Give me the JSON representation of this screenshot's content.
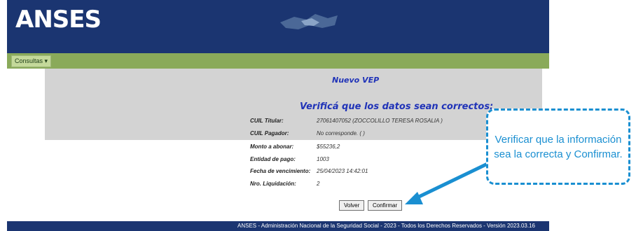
{
  "header": {
    "logo_text": "ANSES"
  },
  "menu": {
    "consultas_label": "Consultas"
  },
  "page": {
    "title": "Nuevo VEP",
    "verify_heading": "Verificá que los datos sean correctos:"
  },
  "fields": [
    {
      "label": "CUIL Titular:",
      "value": "27061407052  (ZOCCOLILLO TERESA ROSALIA )"
    },
    {
      "label": "CUIL Pagador:",
      "value": "No corresponde.  ( )"
    },
    {
      "label": "Monto a abonar:",
      "value": "$55236,2"
    },
    {
      "label": "Entidad de pago:",
      "value": "1003"
    },
    {
      "label": "Fecha de vencimiento:",
      "value": "25/04/2023 14:42:01"
    },
    {
      "label": "Nro. Liquidación:",
      "value": "2"
    }
  ],
  "buttons": {
    "back_label": "Volver",
    "confirm_label": "Confirmar"
  },
  "footer": {
    "text": "ANSES - Administración Nacional de la Seguridad Social - 2023 - Todos los Derechos Reservados - Versión  2023.03.16"
  },
  "callout": {
    "text": "Verificar que la información sea la correcta y Confirmar."
  },
  "colors": {
    "header_bg": "#1b3571",
    "menubar_bg": "#8aaa5a",
    "accent_text": "#2033b8",
    "callout": "#1a8fd1"
  },
  "icons": {
    "menu_dropdown": "chevron-down-icon",
    "header_graphic": "world-map-graphic",
    "pointer": "arrow-icon"
  }
}
